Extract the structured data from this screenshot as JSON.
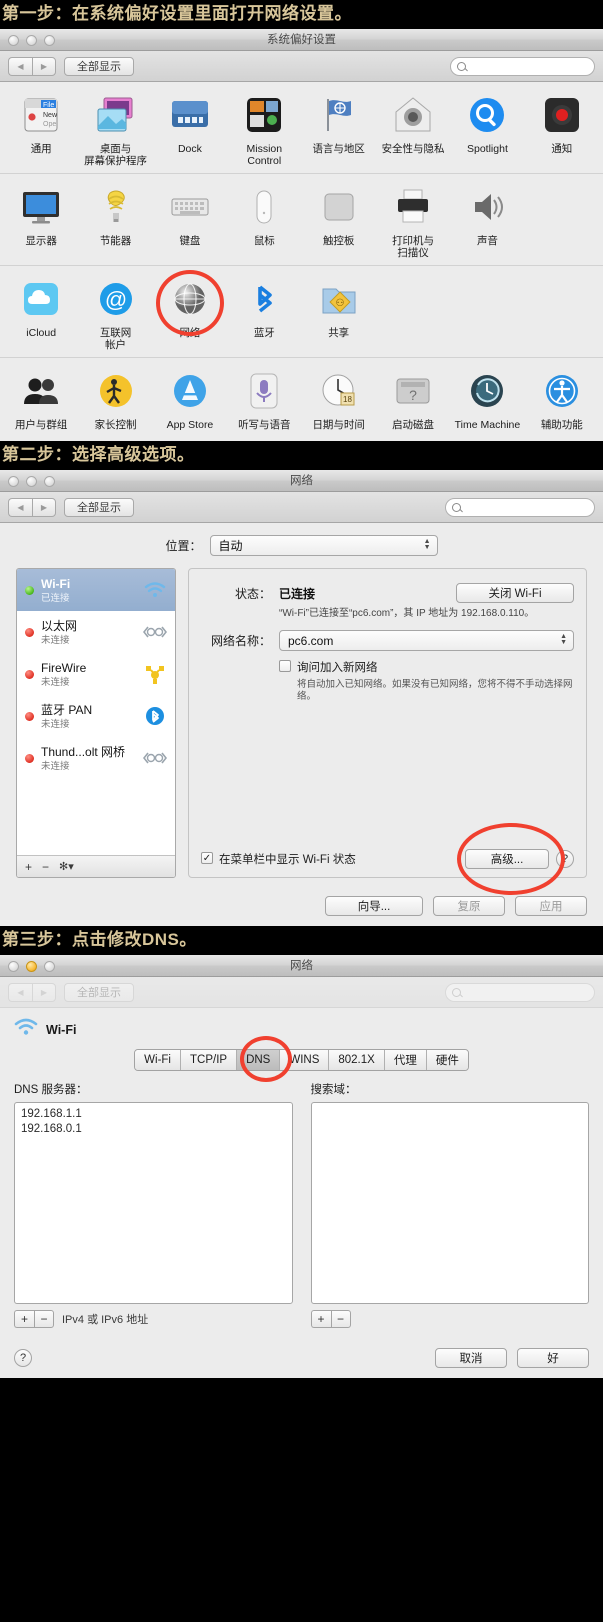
{
  "steps": [
    {
      "caption": "第一步：在系统偏好设置里面打开网络设置。"
    },
    {
      "caption": "第二步：选择高级选项。"
    },
    {
      "caption": "第三步：点击修改DNS。"
    }
  ],
  "sysprefs_window": {
    "title": "系统偏好设置",
    "toolbar": {
      "back_icon": "◀",
      "forward_icon": "▶",
      "show_all_label": "全部显示",
      "search_placeholder": ""
    },
    "rows": [
      [
        {
          "label": "通用",
          "icon": "general-icon"
        },
        {
          "label": "桌面与\n屏幕保护程序",
          "icon": "desktop-screensaver-icon"
        },
        {
          "label": "Dock",
          "icon": "dock-icon"
        },
        {
          "label": "Mission\nControl",
          "icon": "mission-control-icon"
        },
        {
          "label": "语言与地区",
          "icon": "language-region-icon"
        },
        {
          "label": "安全性与隐私",
          "icon": "security-privacy-icon"
        },
        {
          "label": "Spotlight",
          "icon": "spotlight-icon"
        },
        {
          "label": "通知",
          "icon": "notifications-icon"
        }
      ],
      [
        {
          "label": "显示器",
          "icon": "displays-icon"
        },
        {
          "label": "节能器",
          "icon": "energy-saver-icon"
        },
        {
          "label": "键盘",
          "icon": "keyboard-icon"
        },
        {
          "label": "鼠标",
          "icon": "mouse-icon"
        },
        {
          "label": "触控板",
          "icon": "trackpad-icon"
        },
        {
          "label": "打印机与\n扫描仪",
          "icon": "printers-scanners-icon"
        },
        {
          "label": "声音",
          "icon": "sound-icon"
        }
      ],
      [
        {
          "label": "iCloud",
          "icon": "icloud-icon"
        },
        {
          "label": "互联网\n帐户",
          "icon": "internet-accounts-icon"
        },
        {
          "label": "网络",
          "icon": "network-icon",
          "highlighted": true
        },
        {
          "label": "蓝牙",
          "icon": "bluetooth-icon"
        },
        {
          "label": "共享",
          "icon": "sharing-icon"
        }
      ],
      [
        {
          "label": "用户与群组",
          "icon": "users-groups-icon"
        },
        {
          "label": "家长控制",
          "icon": "parental-controls-icon"
        },
        {
          "label": "App Store",
          "icon": "app-store-icon"
        },
        {
          "label": "听写与语音",
          "icon": "dictation-speech-icon"
        },
        {
          "label": "日期与时间",
          "icon": "date-time-icon"
        },
        {
          "label": "启动磁盘",
          "icon": "startup-disk-icon"
        },
        {
          "label": "Time Machine",
          "icon": "time-machine-icon"
        },
        {
          "label": "辅助功能",
          "icon": "accessibility-icon"
        }
      ]
    ]
  },
  "network_window": {
    "title": "网络",
    "toolbar": {
      "show_all_label": "全部显示"
    },
    "location_label": "位置：",
    "location_value": "自动",
    "services": [
      {
        "name": "Wi-Fi",
        "status": "已连接",
        "selected": true,
        "icon": "wifi-icon"
      },
      {
        "name": "以太网",
        "status": "未连接",
        "selected": false,
        "icon": "ethernet-icon"
      },
      {
        "name": "FireWire",
        "status": "未连接",
        "selected": false,
        "icon": "firewire-icon"
      },
      {
        "name": "蓝牙 PAN",
        "status": "未连接",
        "selected": false,
        "icon": "bluetooth-icon"
      },
      {
        "name": "Thund...olt 网桥",
        "status": "未连接",
        "selected": false,
        "icon": "thunderbolt-bridge-icon"
      }
    ],
    "service_footer": {
      "add": "+",
      "remove": "−",
      "gear": "✻▾"
    },
    "status_label": "状态：",
    "status_value": "已连接",
    "toggle_wifi_button": "关闭 Wi-Fi",
    "status_detail": "“Wi-Fi”已连接至“pc6.com”，其 IP 地址为 192.168.0.110。",
    "network_name_label": "网络名称：",
    "network_name_value": "pc6.com",
    "ask_join_label": "询问加入新网络",
    "ask_join_checked": false,
    "ask_join_note": "将自动加入已知网络。如果没有已知网络，您将不得不手动选择网络。",
    "show_status_menubar_label": "在菜单栏中显示 Wi-Fi 状态",
    "show_status_menubar_checked": true,
    "advanced_button": "高级...",
    "help_button": "?",
    "footer_buttons": [
      {
        "label": "向导...",
        "enabled": true
      },
      {
        "label": "复原",
        "enabled": false
      },
      {
        "label": "应用",
        "enabled": false
      }
    ]
  },
  "advanced_window": {
    "title": "网络",
    "toolbar": {
      "show_all_label": "全部显示"
    },
    "interface_name": "Wi-Fi",
    "tabs": [
      {
        "label": "Wi-Fi",
        "active": false
      },
      {
        "label": "TCP/IP",
        "active": false
      },
      {
        "label": "DNS",
        "active": true
      },
      {
        "label": "WINS",
        "active": false
      },
      {
        "label": "802.1X",
        "active": false
      },
      {
        "label": "代理",
        "active": false
      },
      {
        "label": "硬件",
        "active": false
      }
    ],
    "dns_servers_label": "DNS 服务器：",
    "dns_servers": [
      "192.168.1.1",
      "192.168.0.1"
    ],
    "search_domains_label": "搜索域：",
    "search_domains": [],
    "dns_add": "+",
    "dns_remove": "−",
    "dns_hint": "IPv4 或 IPv6 地址",
    "domains_add": "+",
    "domains_remove": "−",
    "help_button": "?",
    "footer_buttons": [
      {
        "label": "取消",
        "primary": false
      },
      {
        "label": "好",
        "primary": true
      }
    ]
  },
  "colors": {
    "highlight_ring": "#f0402f",
    "caption_text": "#d8c69a",
    "window_bg": "#ececec",
    "selection_blue": "#93aecf"
  }
}
